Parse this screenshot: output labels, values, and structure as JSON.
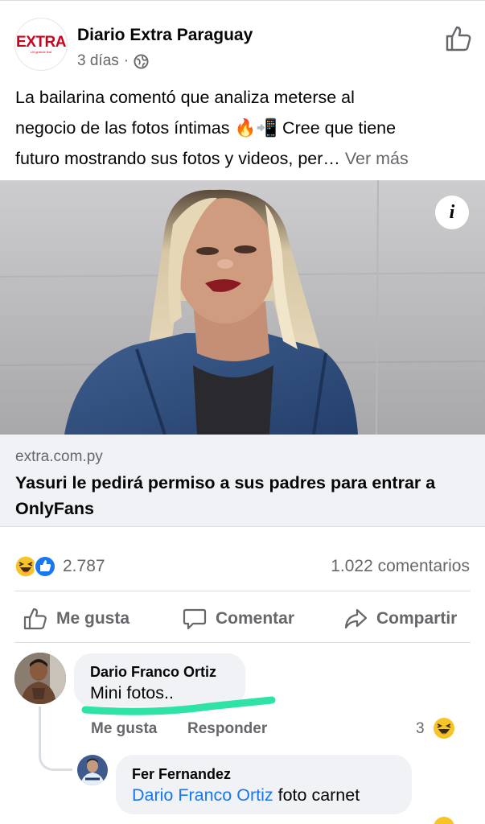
{
  "post": {
    "page_name": "Diario Extra Paraguay",
    "logo_text": "EXTRA",
    "logo_subtext": "Un grande leal",
    "time": "3 días",
    "separator": "·",
    "text_line1": "La bailarina comentó que analiza meterse al",
    "text_line2_start": "negocio de las fotos íntimas",
    "text_line2_end": "Cree que tiene",
    "text_line3": "futuro mostrando sus fotos y videos, per…",
    "emoji_fire": "🔥",
    "emoji_phone": "📲",
    "see_more": "Ver más"
  },
  "link": {
    "domain": "extra.com.py",
    "title": "Yasuri le pedirá permiso a sus padres para entrar a OnlyFans",
    "info_icon_label": "i"
  },
  "stats": {
    "reaction_count": "2.787",
    "comment_count": "1.022 comentarios"
  },
  "actions": {
    "like": "Me gusta",
    "comment": "Comentar",
    "share": "Compartir"
  },
  "comments": [
    {
      "author": "Dario Franco Ortiz",
      "text": "Mini fotos..",
      "like_action": "Me gusta",
      "reply_action": "Responder",
      "reaction_count": "3"
    },
    {
      "author": "Fer Fernandez",
      "mention": "Dario Franco Ortiz",
      "text": "foto carnet"
    }
  ],
  "colors": {
    "brand_blue": "#1877f2",
    "logo_red": "#d0021b",
    "highlight_green": "#2fe3a6",
    "muted_gray": "#65676b"
  }
}
